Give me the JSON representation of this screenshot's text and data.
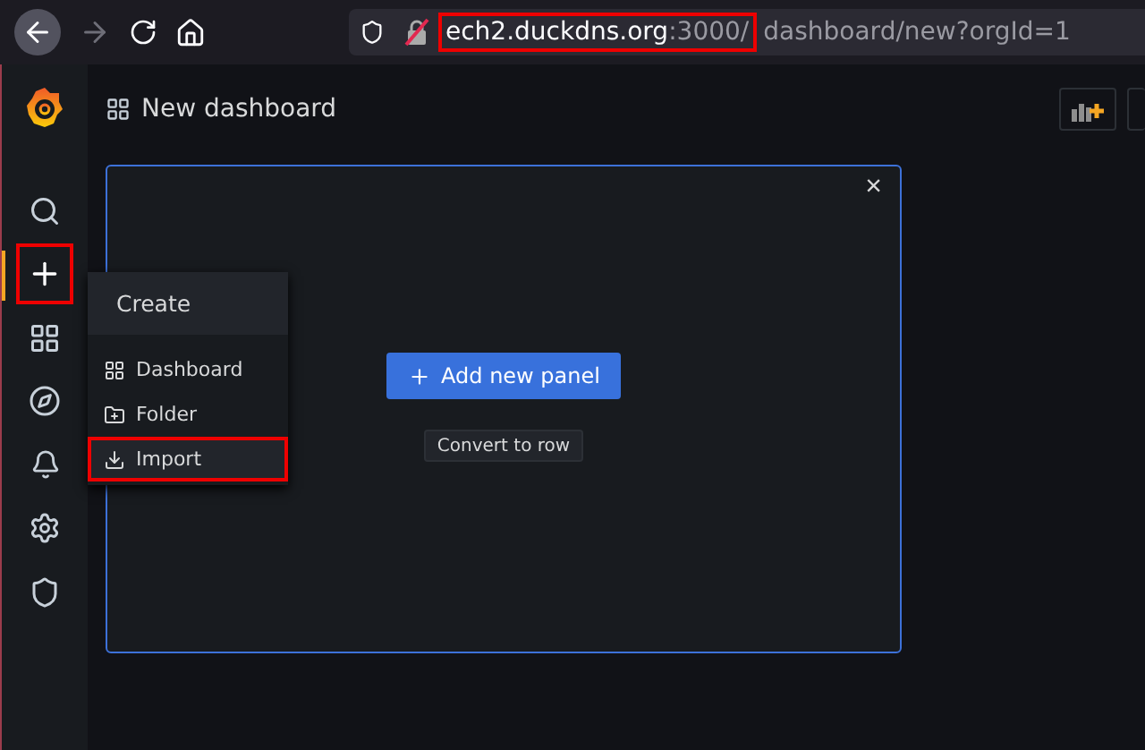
{
  "browser": {
    "url_host": "ech2.duckdns.org",
    "url_port": ":3000/",
    "url_path": "dashboard/new?orgId=1",
    "host_highlighted": true
  },
  "sidebar": {
    "items": [
      {
        "kind": "search",
        "selected": false,
        "highlighted": false
      },
      {
        "kind": "create",
        "selected": true,
        "highlighted": true
      },
      {
        "kind": "dashboards",
        "selected": false,
        "highlighted": false
      },
      {
        "kind": "explore",
        "selected": false,
        "highlighted": false
      },
      {
        "kind": "alerting",
        "selected": false,
        "highlighted": false
      },
      {
        "kind": "configuration",
        "selected": false,
        "highlighted": false
      },
      {
        "kind": "admin",
        "selected": false,
        "highlighted": false
      }
    ]
  },
  "create_menu": {
    "title": "Create",
    "items": [
      {
        "kind": "dashboard",
        "label": "Dashboard",
        "selected": false,
        "highlighted": false
      },
      {
        "kind": "folder",
        "label": "Folder",
        "selected": false,
        "highlighted": false
      },
      {
        "kind": "import",
        "label": "Import",
        "selected": true,
        "highlighted": true
      }
    ]
  },
  "header": {
    "title": "New dashboard"
  },
  "panel": {
    "close": "×",
    "add_button": "Add new panel",
    "convert_button": "Convert to row"
  }
}
